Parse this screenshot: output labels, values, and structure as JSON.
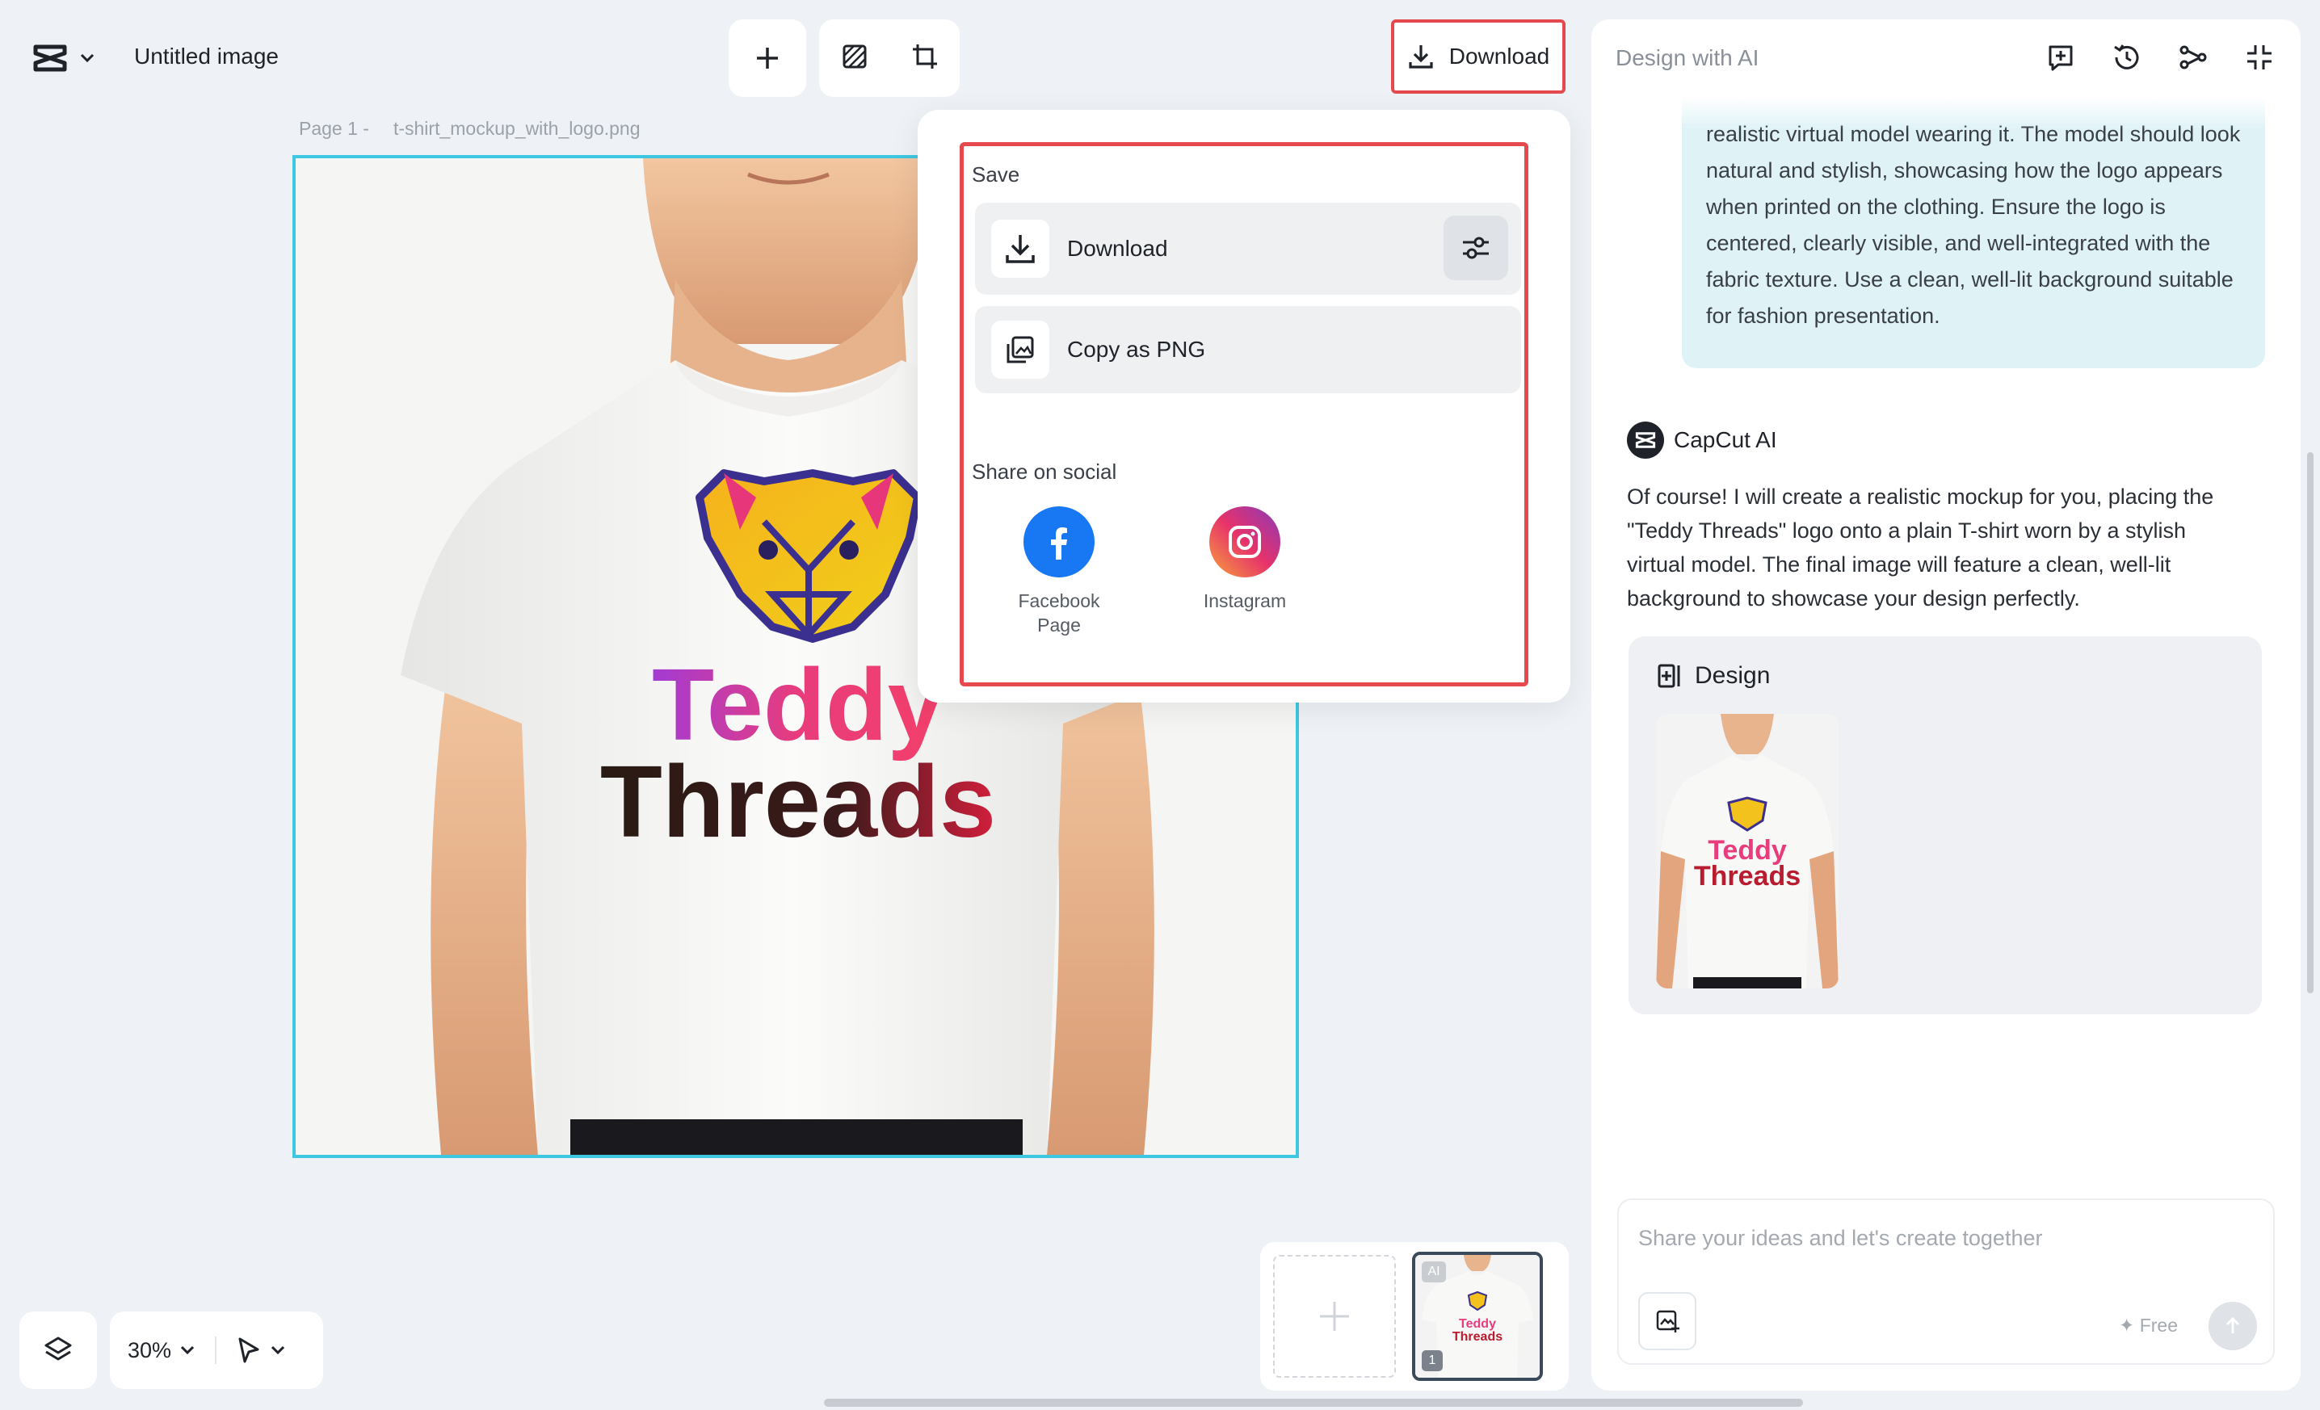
{
  "app": {
    "doc_title": "Untitled image",
    "download_label": "Download",
    "page_label": "Page 1 -",
    "file_name": "t-shirt_mockup_with_logo.png"
  },
  "canvas": {
    "logo_line1": "Teddy",
    "logo_line2": "Threads"
  },
  "dropdown": {
    "save_section": "Save",
    "download_label": "Download",
    "copy_label": "Copy as PNG",
    "share_section": "Share on social",
    "social": [
      {
        "label_line1": "Facebook",
        "label_line2": "Page",
        "icon": "facebook-icon"
      },
      {
        "label_line1": "Instagram",
        "label_line2": "",
        "icon": "instagram-icon"
      }
    ]
  },
  "right_panel": {
    "title": "Design with AI",
    "user_message": "realistic virtual model wearing it. The model should look natural and stylish, showcasing how the logo appears when printed on the clothing. Ensure the logo is centered, clearly visible, and well-integrated with the fabric texture. Use a clean, well-lit background suitable for fashion presentation.",
    "ai_name": "CapCut AI",
    "ai_message": "Of course! I will create a realistic mockup for you, placing the \"Teddy Threads\" logo onto a plain T-shirt worn by a stylish virtual model. The final image will feature a clean, well-lit background to showcase your design perfectly.",
    "design_title": "Design",
    "input_placeholder": "Share your ideas and let's create together",
    "free_label": "✦ Free"
  },
  "bottom": {
    "zoom": "30%",
    "thumb_tag": "AI",
    "thumb_num": "1"
  },
  "colors": {
    "accent_border": "#e5484d",
    "canvas_border": "#3ec7e0",
    "user_bubble": "#dff3f7"
  }
}
